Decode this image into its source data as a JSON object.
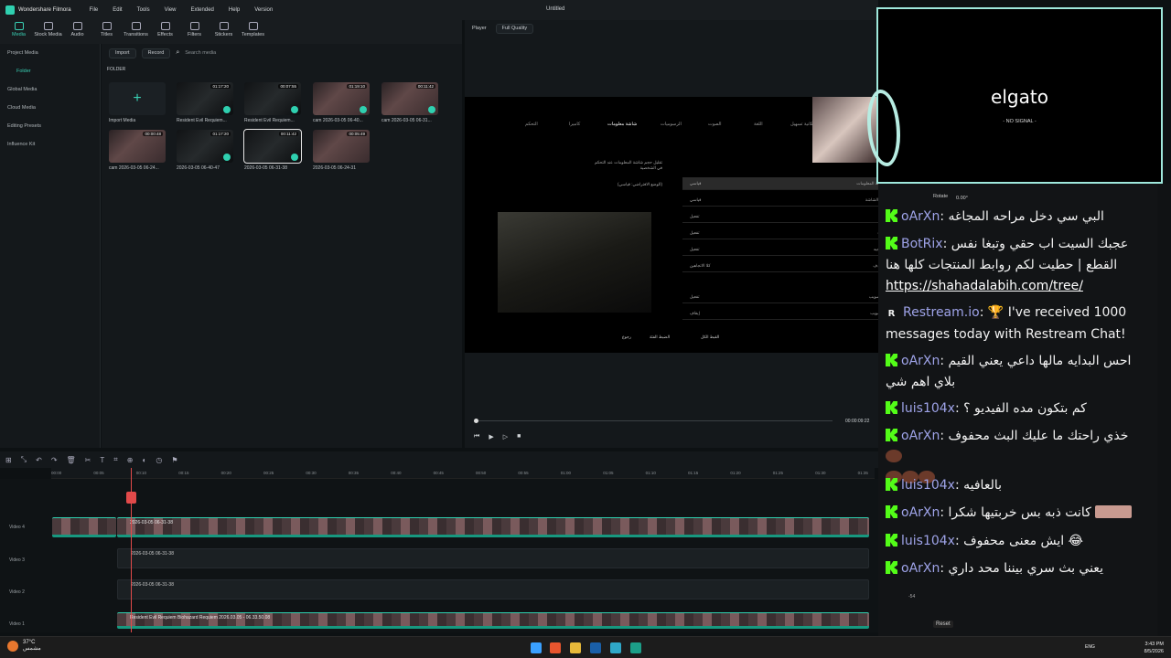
{
  "app": {
    "name": "Wondershare Filmora",
    "document": "Untitled",
    "menu": [
      "File",
      "Edit",
      "Tools",
      "View",
      "Extended",
      "Help",
      "Version"
    ]
  },
  "toolbar": [
    "Media",
    "Stock Media",
    "Audio",
    "Titles",
    "Transitions",
    "Effects",
    "Filters",
    "Stickers",
    "Templates"
  ],
  "sidebar": [
    "Project Media",
    "Folder",
    "Global Media",
    "Cloud Media",
    "Editing Presets",
    "Influence Kit"
  ],
  "media": {
    "import_label": "Import",
    "record_label": "Record",
    "search_placeholder": "Search media",
    "folder_label": "FOLDER",
    "items": [
      {
        "name": "Import Media",
        "duration": ""
      },
      {
        "name": "Resident Evil Requiem...",
        "duration": "01:17:20"
      },
      {
        "name": "Resident Evil Requiem...",
        "duration": "00:07:55"
      },
      {
        "name": "cam 2026-03-05 06-40...",
        "duration": "01:19:10"
      },
      {
        "name": "cam 2026-03-05 06-31...",
        "duration": "00:11:42"
      },
      {
        "name": "cam 2026-03-05 06-24...",
        "duration": "00:00:48"
      },
      {
        "name": "2026-03-05 06-40-47",
        "duration": "01:17:20"
      },
      {
        "name": "2026-03-05 06-31-38",
        "duration": "00:11:42"
      },
      {
        "name": "2026-03-05 06-24-31",
        "duration": "00:05:49"
      }
    ]
  },
  "player": {
    "label": "Player",
    "quality": "Full Quality",
    "timecode": "00:00:09:22",
    "game_tabs": [
      "التحكم",
      "كاميرا",
      "شاشة معلومات",
      "الرسوميات",
      "الصوت",
      "اللغة",
      "إمكانية تسهيل"
    ],
    "game_desc": "تقليل حجم شاشة المعلومات عند التحكم في الشخصية",
    "game_desc2": "(الوضع الافتراضي: قياسي)",
    "game_rows": [
      {
        "label": "حجم شاشة المعلومات",
        "value": "قياسي"
      },
      {
        "label": "حجم نص الشاشة",
        "value": "قياسي"
      },
      {
        "label": "الصحة",
        "value": "تفعيل"
      },
      {
        "label": "الإرشادات",
        "value": "تفعيل"
      },
      {
        "label": "أزرار التوجيه",
        "value": "تفعيل"
      },
      {
        "label": "عرض الهدف",
        "value": "كلا الاتجاهين"
      },
      {
        "label": "مؤشر التصويب",
        "value": "تفعيل"
      },
      {
        "label": "نقطة التصويب",
        "value": "إيقاف"
      }
    ],
    "game_footer": [
      "القبط الكل",
      "الضبط الفئة",
      "رجوع"
    ]
  },
  "timeline": {
    "ruler": [
      "00:00",
      "00:05",
      "00:10",
      "00:15",
      "00:20",
      "00:25",
      "00:30",
      "00:35",
      "00:40",
      "00:45",
      "00:50",
      "00:55",
      "01:00",
      "01:05",
      "01:10",
      "01:15",
      "01:20",
      "01:25",
      "01:30",
      "01:35"
    ],
    "tracks": [
      {
        "name": "Video 4",
        "clip": "2026-03-05 06-31-38"
      },
      {
        "name": "Video 3",
        "clip": "2026-03-05 06-31-38"
      },
      {
        "name": "Video 2",
        "clip": "2026-03-05 06-31-38"
      },
      {
        "name": "Video 1",
        "clip": "Resident Evil Requiem Biohazard Requiem 2026.03.05 - 06.33.50.08"
      }
    ]
  },
  "overlay": {
    "brand": "elgato",
    "status": "- NO SIGNAL -"
  },
  "chat": {
    "rotate_label": "Rotate",
    "rotate_value": "0.00°",
    "messages": [
      {
        "user": "oArXn",
        "text": "البي سي دخل مراحه المجاغه",
        "badge": "kick"
      },
      {
        "user": "BotRix",
        "text": "عجبك السيت اب حقي وتبغا نفس القطع | حطيت لكم روابط المنتجات كلها هنا",
        "link": "https://shahadalabih.com/tree/",
        "badge": "kick"
      },
      {
        "user": "Restream.io",
        "text": "🏆 I've received 1000 messages today with Restream Chat!",
        "badge": "restream"
      },
      {
        "user": "oArXn",
        "text": "احس البدايه مالها داعي يعني القيم بلاي اهم شي",
        "badge": "kick"
      },
      {
        "user": "luis104x",
        "text": "كم بتكون مده الفيديو ؟",
        "badge": "kick"
      },
      {
        "user": "oArXn",
        "text": "خذي راحتك ما عليك البث محفوف",
        "badge": "kick"
      },
      {
        "user": "luis104x",
        "text": "بالعافيه",
        "badge": "kick"
      },
      {
        "user": "oArXn",
        "text": "كانت ذبه بس خربتيها شكرا",
        "badge": "kick"
      },
      {
        "user": "luis104x",
        "text": "ايش معنى محفوف 😂",
        "badge": "kick"
      },
      {
        "user": "oArXn",
        "text": "يعني بث سري بيننا محد داري",
        "badge": "kick"
      }
    ]
  },
  "mixer": {
    "reset": "Reset",
    "db": "-54"
  },
  "taskbar": {
    "temp": "37°C",
    "weather": "مشمس",
    "lang": "ENG",
    "time": "3:43 PM",
    "date": "8/5/2026"
  }
}
